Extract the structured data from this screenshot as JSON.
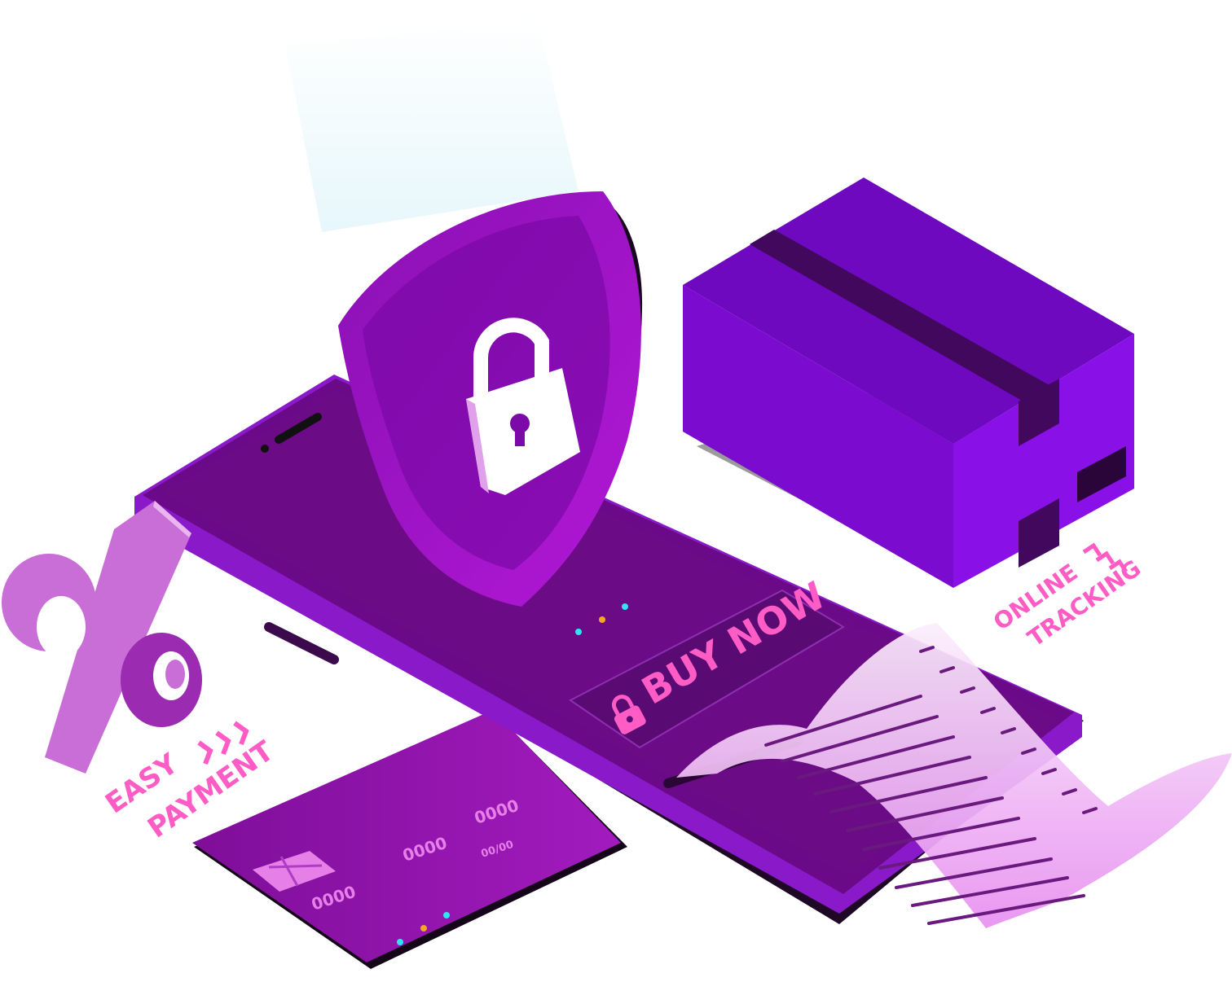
{
  "labels": {
    "buy_now": "BUY NOW",
    "easy": "EASY",
    "payment": "PAYMENT",
    "online": "ONLINE",
    "tracking": "TRACKING",
    "percent_symbol": "%",
    "card_group_1": "0000",
    "card_group_2": "0000",
    "card_group_3": "0000",
    "card_expiry": "00/00"
  },
  "colors": {
    "phone_body": "#6a0a88",
    "phone_rim": "#8a19c9",
    "phone_dark": "#220a2c",
    "screen": "#6b0b85",
    "shield": "#7a0aa6",
    "shield_light": "#a017c4",
    "lock": "#ffffff",
    "box_top": "#6e09c0",
    "box_left": "#7b0bcf",
    "box_right": "#8a10e8",
    "box_tape": "#41085e",
    "card": "#8e16b0",
    "receipt": "#f3d2f7",
    "receipt_lines": "#6a1a7e",
    "accent_pink": "#ff5cc5",
    "percent": "#c86ed6",
    "dot_cyan": "#2ee6f2",
    "dot_orange": "#f5a623",
    "chip": "#e680e8"
  }
}
